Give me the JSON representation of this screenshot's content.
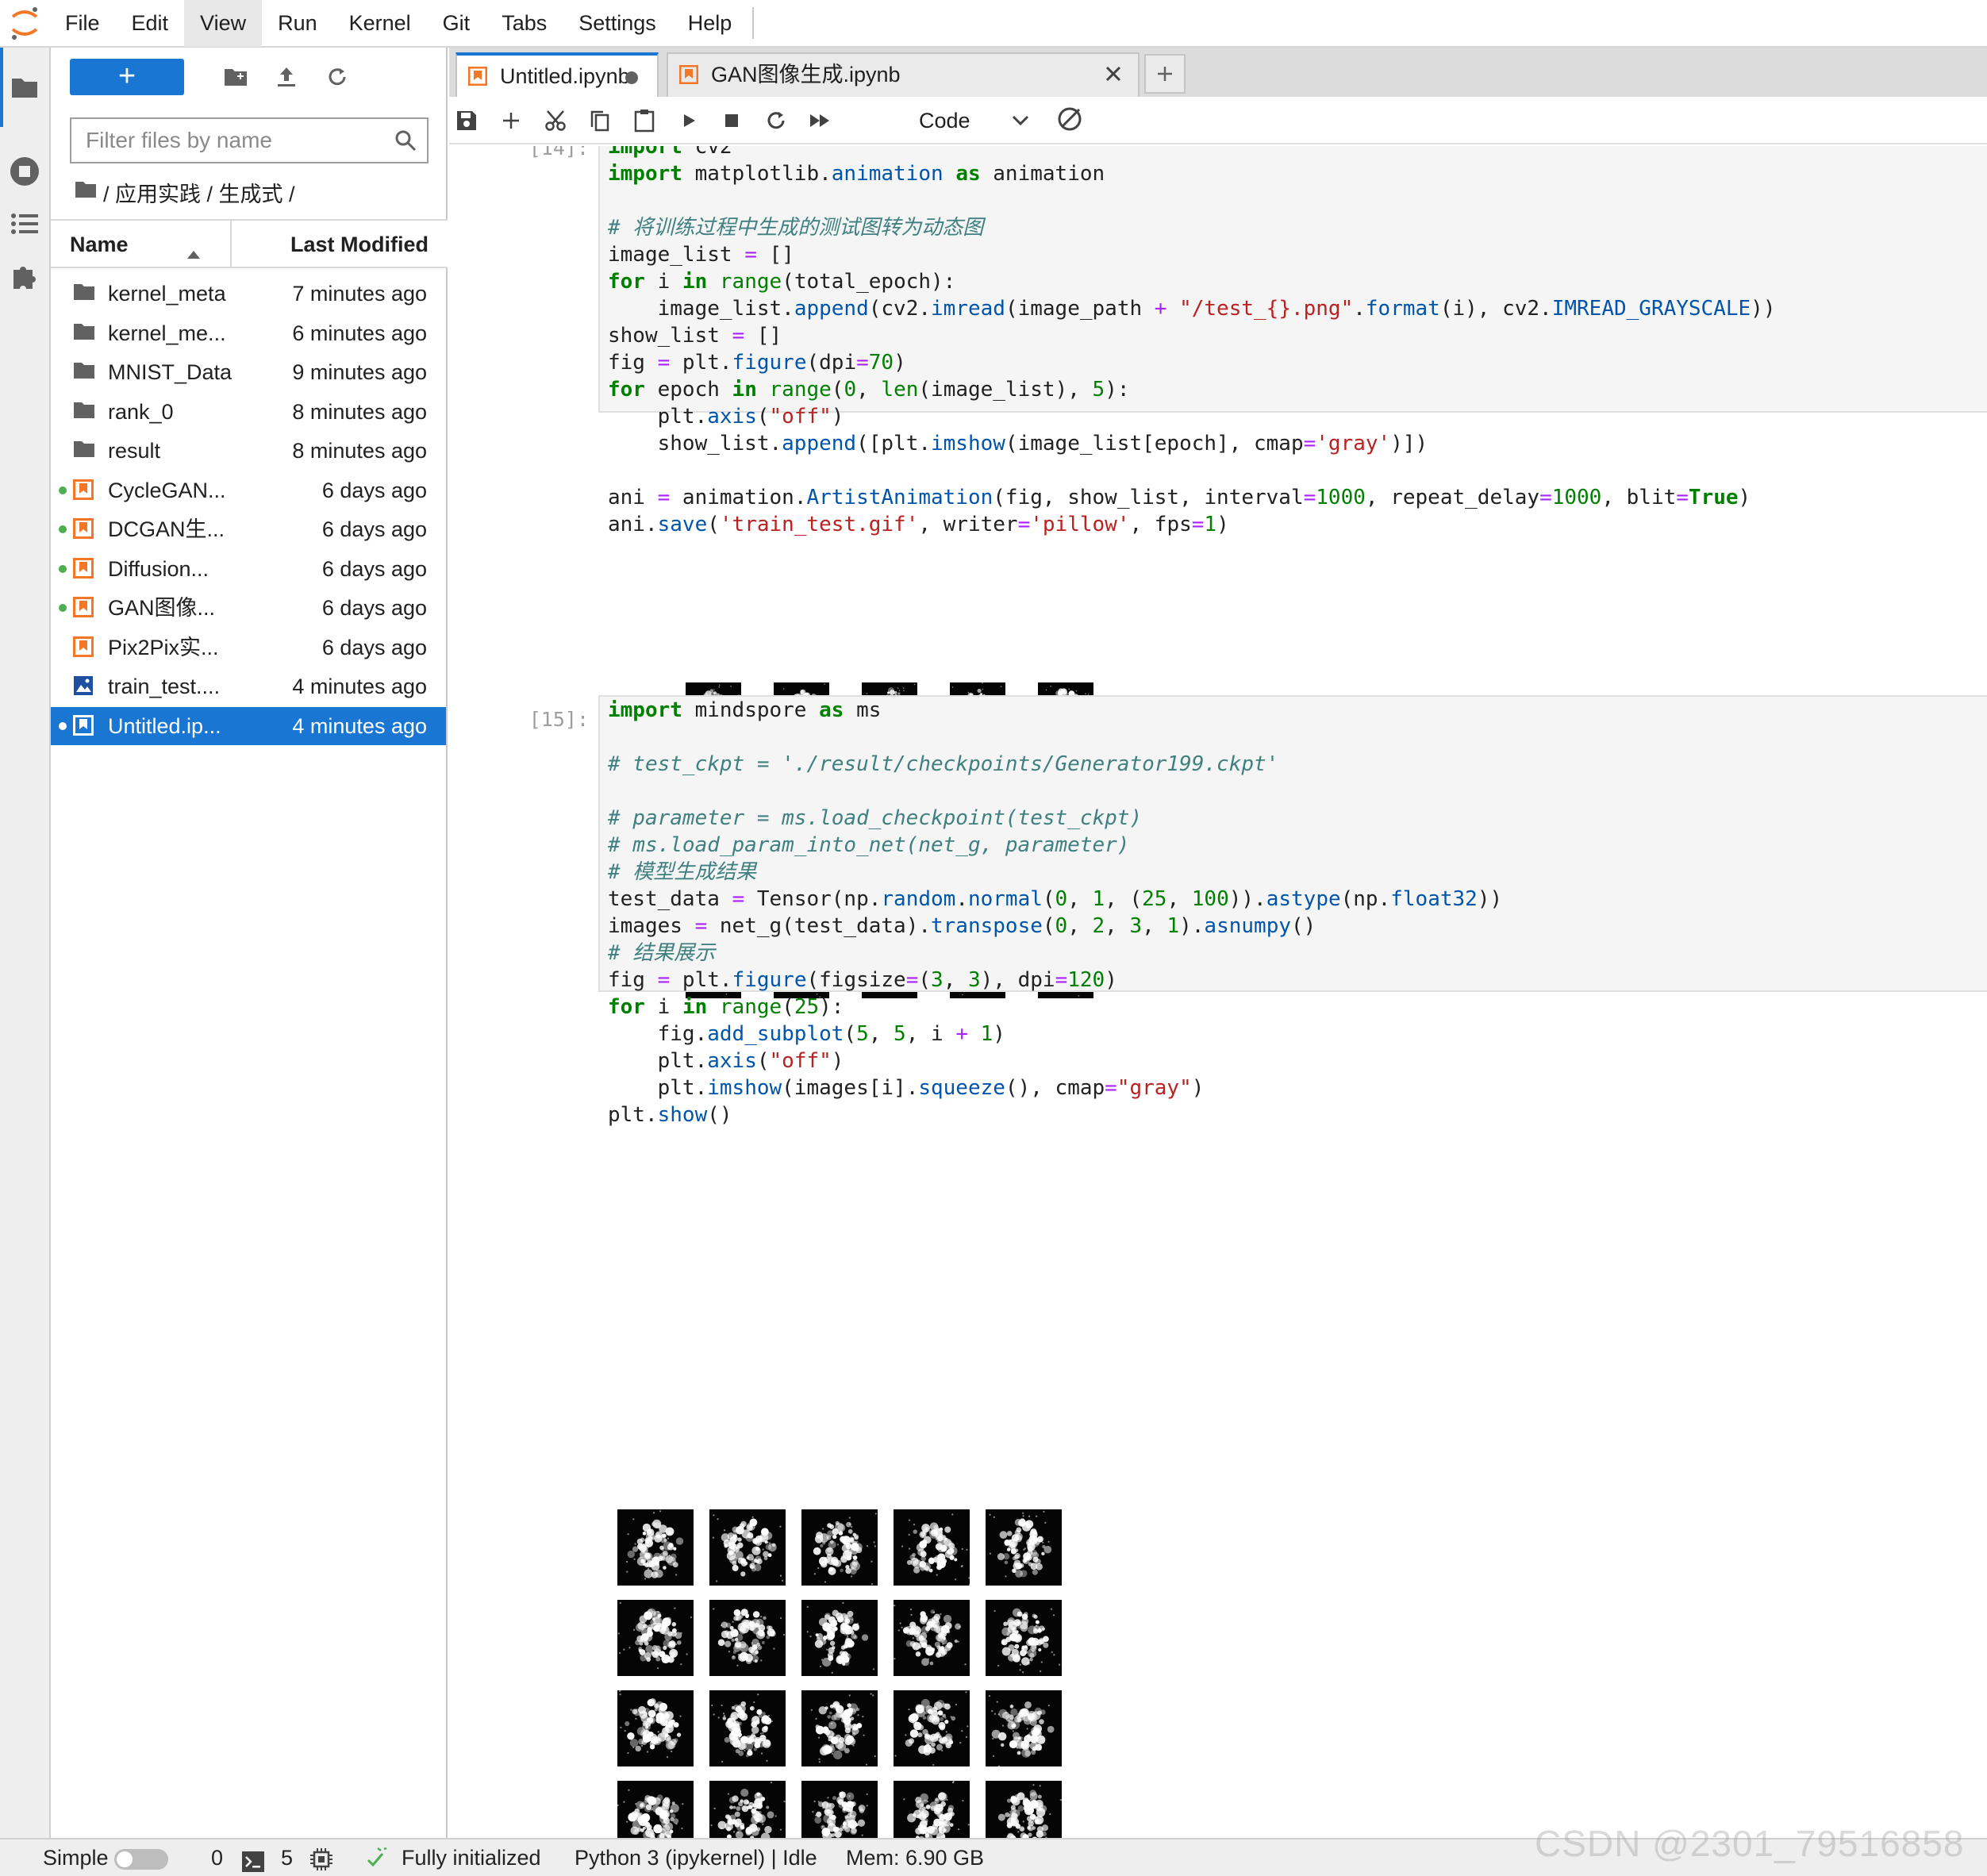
{
  "menubar": {
    "items": [
      "File",
      "Edit",
      "View",
      "Run",
      "Kernel",
      "Git",
      "Tabs",
      "Settings",
      "Help"
    ],
    "active": "View"
  },
  "filebrowser": {
    "filter_placeholder": "Filter files by name",
    "breadcrumb": [
      "应用实践",
      "生成式"
    ],
    "breadcrumb_text": "/ 应用实践 / 生成式 /",
    "col_name": "Name",
    "col_modified": "Last Modified",
    "files": [
      {
        "name": "kernel_meta",
        "modified": "7 minutes ago",
        "type": "folder",
        "running": false
      },
      {
        "name": "kernel_me...",
        "modified": "6 minutes ago",
        "type": "folder",
        "running": false
      },
      {
        "name": "MNIST_Data",
        "modified": "9 minutes ago",
        "type": "folder",
        "running": false
      },
      {
        "name": "rank_0",
        "modified": "8 minutes ago",
        "type": "folder",
        "running": false
      },
      {
        "name": "result",
        "modified": "8 minutes ago",
        "type": "folder",
        "running": false
      },
      {
        "name": "CycleGAN...",
        "modified": "6 days ago",
        "type": "notebook",
        "running": true
      },
      {
        "name": "DCGAN生...",
        "modified": "6 days ago",
        "type": "notebook",
        "running": true
      },
      {
        "name": "Diffusion...",
        "modified": "6 days ago",
        "type": "notebook",
        "running": true
      },
      {
        "name": "GAN图像...",
        "modified": "6 days ago",
        "type": "notebook",
        "running": true
      },
      {
        "name": "Pix2Pix实...",
        "modified": "6 days ago",
        "type": "notebook",
        "running": false
      },
      {
        "name": "train_test....",
        "modified": "4 minutes ago",
        "type": "image",
        "running": false
      },
      {
        "name": "Untitled.ip...",
        "modified": "4 minutes ago",
        "type": "notebook",
        "running": true,
        "selected": true
      }
    ]
  },
  "tabs": [
    {
      "label": "Untitled.ipynb",
      "active": true,
      "dirty": true
    },
    {
      "label": "GAN图像生成.ipynb",
      "active": false,
      "dirty": false
    }
  ],
  "toolbar": {
    "cell_type": "Code"
  },
  "cells": [
    {
      "prompt": "[14]:",
      "code": "import cv2\nimport matplotlib.animation as animation\n\n# 将训练过程中生成的测试图转为动态图\nimage_list = []\nfor i in range(total_epoch):\n    image_list.append(cv2.imread(image_path + \"/test_{}.png\".format(i), cv2.IMREAD_GRAYSCALE))\nshow_list = []\nfig = plt.figure(dpi=70)\nfor epoch in range(0, len(image_list), 5):\n    plt.axis(\"off\")\n    show_list.append([plt.imshow(image_list[epoch], cmap='gray')])\n\nani = animation.ArtistAnimation(fig, show_list, interval=1000, repeat_delay=1000, blit=True)\nani.save('train_test.gif', writer='pillow', fps=1)"
    },
    {
      "prompt": "[15]:",
      "code": "import mindspore as ms\n\n# test_ckpt = './result/checkpoints/Generator199.ckpt'\n\n# parameter = ms.load_checkpoint(test_ckpt)\n# ms.load_param_into_net(net_g, parameter)\n# 模型生成结果\ntest_data = Tensor(np.random.normal(0, 1, (25, 100)).astype(np.float32))\nimages = net_g(test_data).transpose(0, 2, 3, 1).asnumpy()\n# 结果展示\nfig = plt.figure(figsize=(3, 3), dpi=120)\nfor i in range(25):\n    fig.add_subplot(5, 5, i + 1)\n    plt.axis(\"off\")\n    plt.imshow(images[i].squeeze(), cmap=\"gray\")\nplt.show()"
    }
  ],
  "statusbar": {
    "mode": "Simple",
    "terminals": "0",
    "kernels": "5",
    "init_status": "Fully initialized",
    "kernel": "Python 3 (ipykernel) | Idle",
    "memory": "Mem: 6.90 GB"
  },
  "watermark": "CSDN @2301_79516858",
  "colors": {
    "accent": "#1976d2",
    "notebook_icon": "#f37726",
    "running_dot": "#4caf50"
  }
}
